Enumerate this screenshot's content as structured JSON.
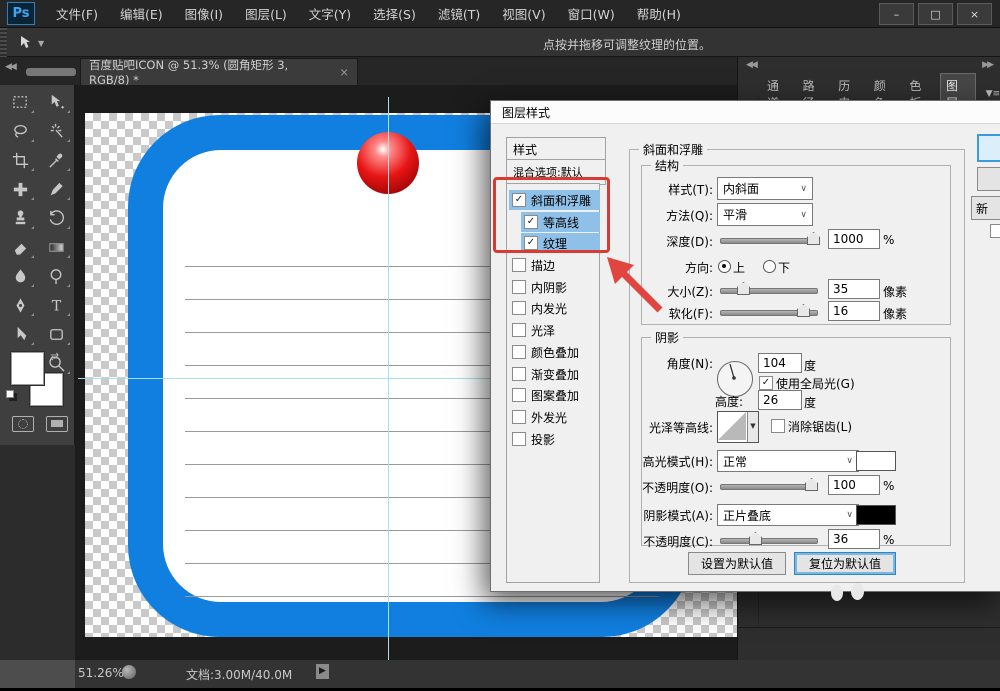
{
  "window": {
    "logo": "Ps",
    "menus": [
      "文件(F)",
      "编辑(E)",
      "图像(I)",
      "图层(L)",
      "文字(Y)",
      "选择(S)",
      "滤镜(T)",
      "视图(V)",
      "窗口(W)",
      "帮助(H)"
    ],
    "controls": {
      "minimize": "–",
      "maximize": "□",
      "close": "×"
    }
  },
  "options_bar": {
    "hint": "点按并拖移可调整纹理的位置。"
  },
  "document_tab": {
    "title": "百度贴吧ICON @ 51.3% (圆角矩形 3, RGB/8) *",
    "close": "×"
  },
  "toolbar": {
    "tools": [
      "rectangular-marquee",
      "move",
      "lasso",
      "magic-wand",
      "crop",
      "eyedropper",
      "spot-healing-brush",
      "brush",
      "clone-stamp",
      "history-brush",
      "eraser",
      "gradient",
      "blur",
      "dodge",
      "pen",
      "horizontal-type",
      "path-selection",
      "rectangle-shape",
      "hand",
      "zoom"
    ],
    "foreground_color": "#ffffff",
    "background_color": "#ffffff"
  },
  "panels": {
    "tabs": [
      "通道",
      "路径",
      "历史",
      "颜色",
      "色板",
      "图层"
    ],
    "active_tab": "图层"
  },
  "dialog": {
    "title": "图层样式",
    "styles_header": "样式",
    "blending_options": "混合选项:默认",
    "styles": [
      {
        "label": "斜面和浮雕",
        "checked": true,
        "selected": true
      },
      {
        "label": "等高线",
        "checked": true,
        "selected": true
      },
      {
        "label": "纹理",
        "checked": true,
        "selected": true
      },
      {
        "label": "描边",
        "checked": false
      },
      {
        "label": "内阴影",
        "checked": false
      },
      {
        "label": "内发光",
        "checked": false
      },
      {
        "label": "光泽",
        "checked": false
      },
      {
        "label": "颜色叠加",
        "checked": false
      },
      {
        "label": "渐变叠加",
        "checked": false
      },
      {
        "label": "图案叠加",
        "checked": false
      },
      {
        "label": "外发光",
        "checked": false
      },
      {
        "label": "投影",
        "checked": false
      }
    ],
    "section_title": "斜面和浮雕",
    "structure": {
      "legend": "结构",
      "style_label": "样式(T):",
      "style_value": "内斜面",
      "method_label": "方法(Q):",
      "method_value": "平滑",
      "depth_label": "深度(D):",
      "depth_value": "1000",
      "depth_unit": "%",
      "direction_label": "方向:",
      "direction_up": "上",
      "direction_down": "下",
      "direction_selected": "上",
      "size_label": "大小(Z):",
      "size_value": "35",
      "size_unit": "像素",
      "soften_label": "软化(F):",
      "soften_value": "16",
      "soften_unit": "像素"
    },
    "shading": {
      "legend": "阴影",
      "angle_label": "角度(N):",
      "angle_value": "104",
      "angle_unit": "度",
      "use_global_light": "使用全局光(G)",
      "use_global_light_checked": true,
      "altitude_label": "高度:",
      "altitude_value": "26",
      "altitude_unit": "度",
      "gloss_contour_label": "光泽等高线:",
      "antialias_label": "消除锯齿(L)",
      "antialias_checked": false,
      "highlight_mode_label": "高光模式(H):",
      "highlight_mode_value": "正常",
      "highlight_color": "#ffffff",
      "opacity_highlight_label": "不透明度(O):",
      "opacity_highlight_value": "100",
      "opacity_highlight_unit": "%",
      "shadow_mode_label": "阴影模式(A):",
      "shadow_mode_value": "正片叠底",
      "shadow_color": "#000000",
      "opacity_shadow_label": "不透明度(C):",
      "opacity_shadow_value": "36",
      "opacity_shadow_unit": "%"
    },
    "buttons": {
      "set_default": "设置为默认值",
      "reset_default": "复位为默认值",
      "new_style_partial": "新"
    }
  },
  "status_bar": {
    "zoom": "51.26%",
    "doc_info": "文档:3.00M/40.0M"
  },
  "colors": {
    "accent_blue": "#107fe0",
    "ball_red": "#e01010",
    "guide_cyan": "#a8dfe8",
    "selection_blue": "#8fc0e8",
    "annotation_red": "#d83a34"
  }
}
